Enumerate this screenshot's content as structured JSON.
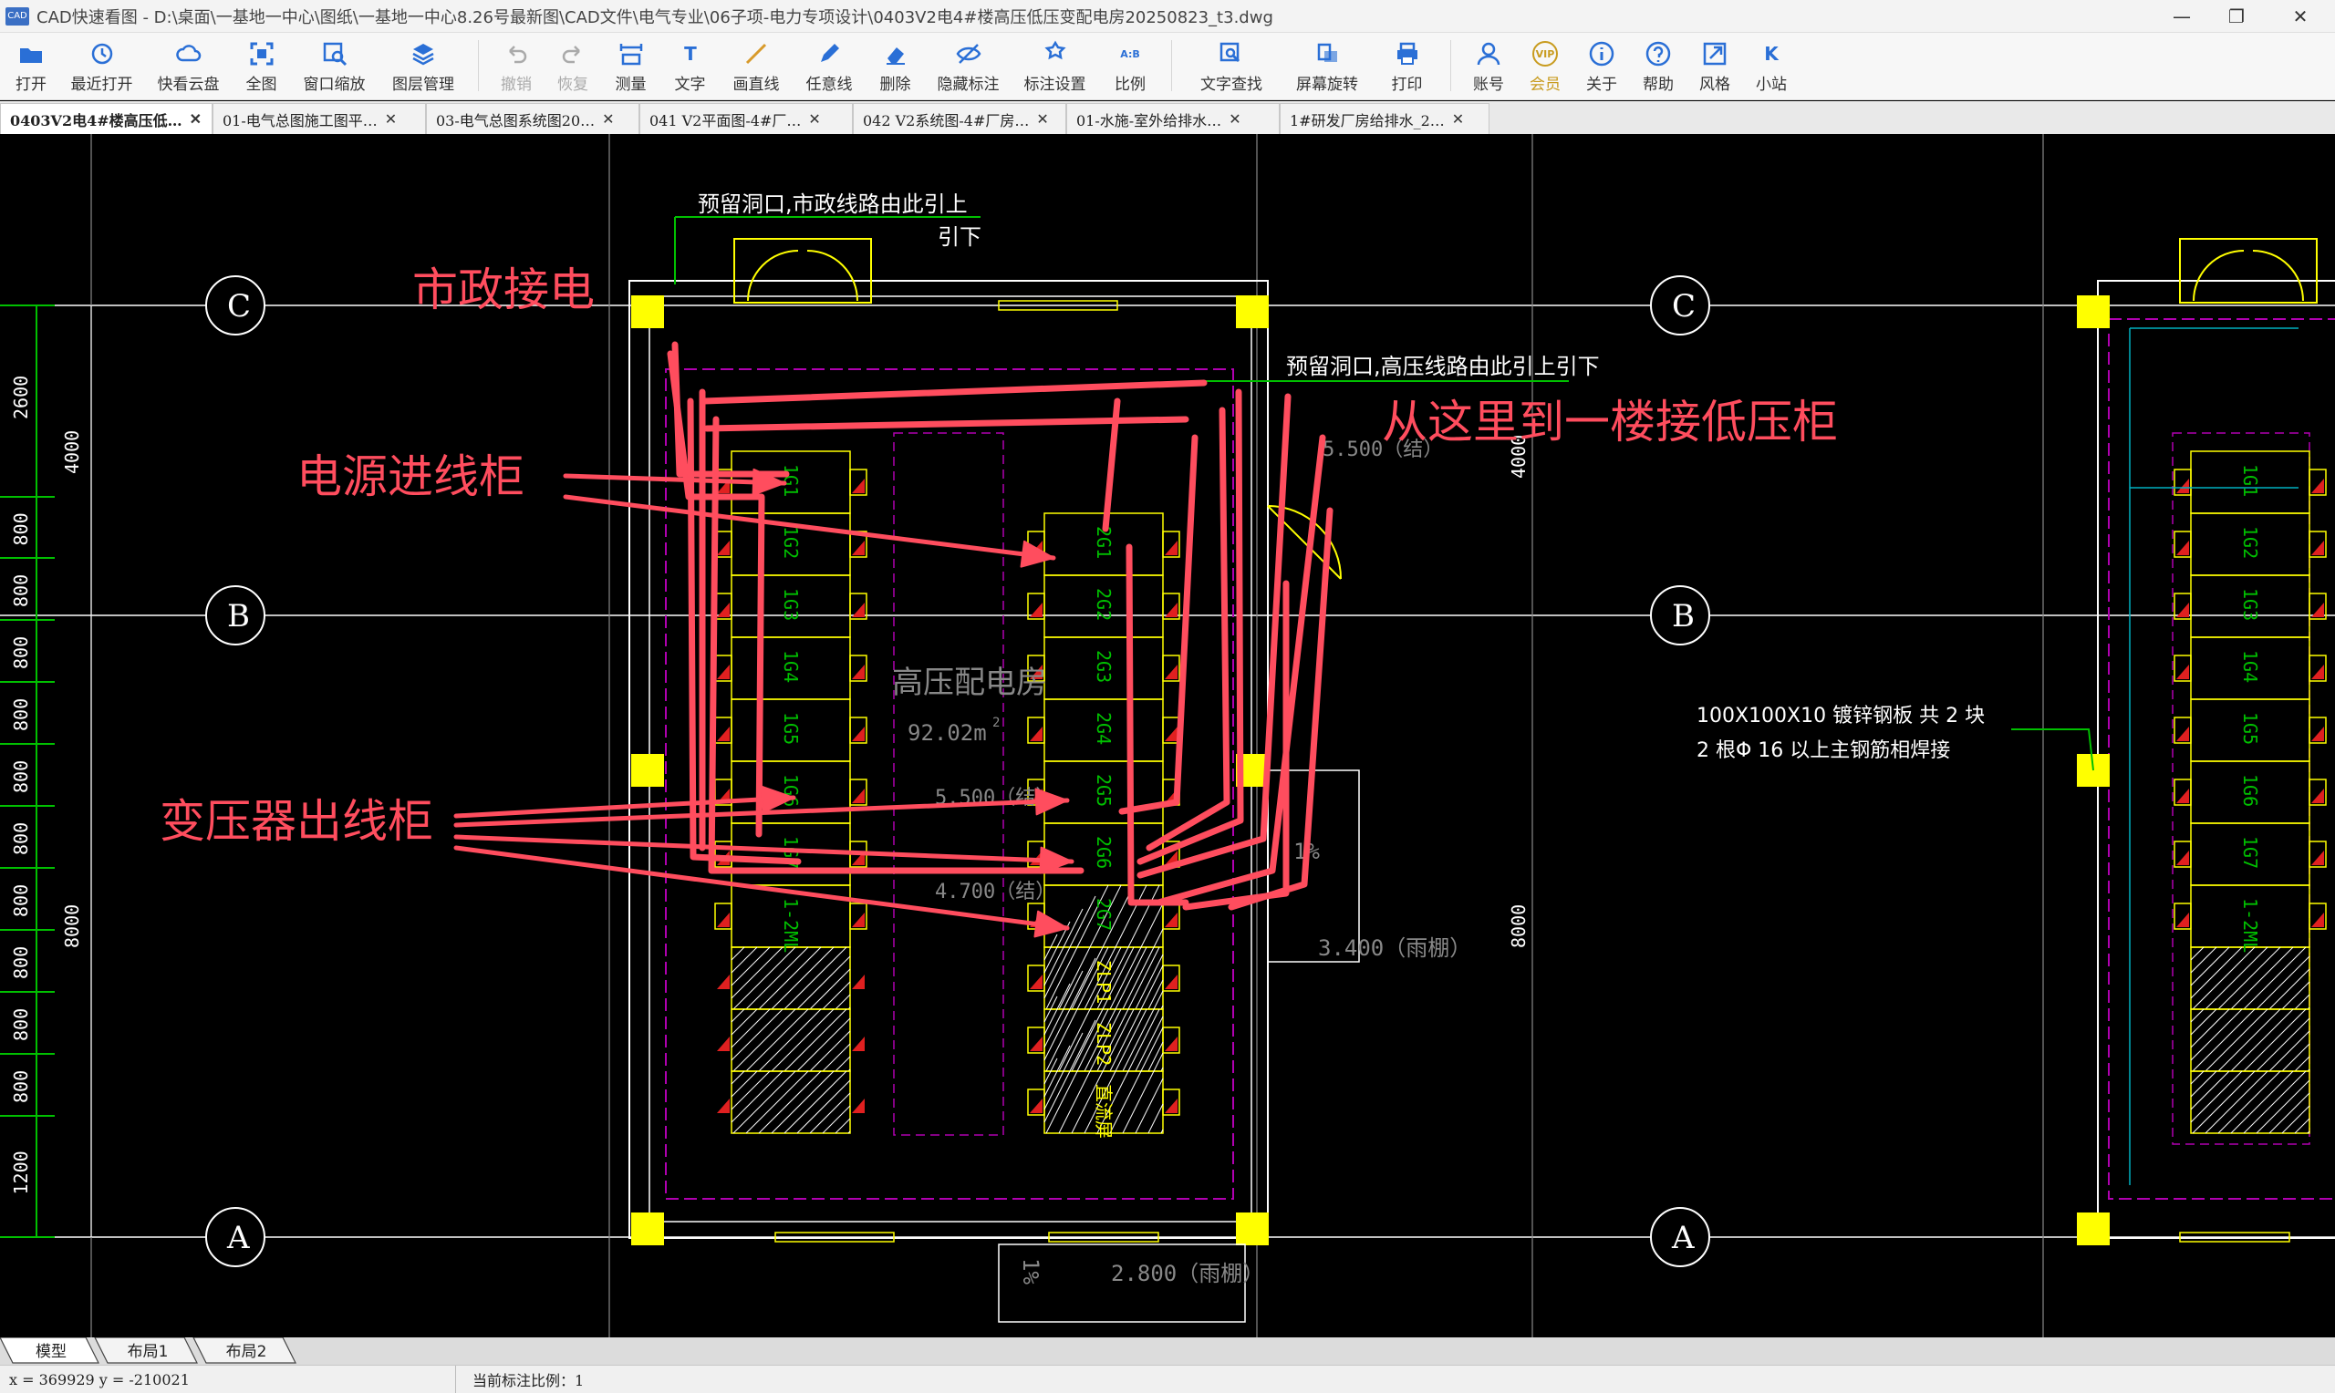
{
  "window": {
    "title": "CAD快速看图 - D:\\桌面\\一基地一中心\\图纸\\一基地一中心8.26号最新图\\CAD文件\\电气专业\\06子项-电力专项设计\\0403V2电4#楼高压低压变配电房20250823_t3.dwg",
    "logo": "CAD",
    "minimize": "—",
    "maximize": "❐",
    "close": "✕"
  },
  "toolbar": [
    {
      "label": "打开",
      "icon": "folder-icon",
      "state": "normal"
    },
    {
      "label": "最近打开",
      "icon": "clock-icon",
      "state": "normal"
    },
    {
      "label": "快看云盘",
      "icon": "cloud-icon",
      "state": "normal"
    },
    {
      "label": "全图",
      "icon": "fit-icon",
      "state": "normal"
    },
    {
      "label": "窗口缩放",
      "icon": "window-zoom-icon",
      "state": "normal"
    },
    {
      "label": "图层管理",
      "icon": "layers-icon",
      "state": "normal"
    },
    {
      "label": "撤销",
      "icon": "undo-icon",
      "state": "disabled"
    },
    {
      "label": "恢复",
      "icon": "redo-icon",
      "state": "disabled"
    },
    {
      "label": "测量",
      "icon": "measure-icon",
      "state": "normal"
    },
    {
      "label": "文字",
      "icon": "text-icon",
      "state": "normal"
    },
    {
      "label": "画直线",
      "icon": "line-icon",
      "state": "normal"
    },
    {
      "label": "任意线",
      "icon": "pen-icon",
      "state": "normal"
    },
    {
      "label": "删除",
      "icon": "eraser-icon",
      "state": "normal"
    },
    {
      "label": "隐藏标注",
      "icon": "eye-off-icon",
      "state": "normal"
    },
    {
      "label": "标注设置",
      "icon": "annotation-settings-icon",
      "state": "normal"
    },
    {
      "label": "比例",
      "icon": "scale-icon",
      "state": "normal"
    },
    {
      "label": "文字查找",
      "icon": "text-search-icon",
      "state": "normal"
    },
    {
      "label": "屏幕旋转",
      "icon": "rotate-icon",
      "state": "normal"
    },
    {
      "label": "打印",
      "icon": "printer-icon",
      "state": "normal"
    },
    {
      "label": "账号",
      "icon": "user-icon",
      "state": "normal"
    },
    {
      "label": "会员",
      "icon": "vip-icon",
      "state": "gold"
    },
    {
      "label": "关于",
      "icon": "info-icon",
      "state": "normal"
    },
    {
      "label": "帮助",
      "icon": "help-icon",
      "state": "normal"
    },
    {
      "label": "风格",
      "icon": "style-icon",
      "state": "normal"
    },
    {
      "label": "小站",
      "icon": "k-site-icon",
      "state": "normal"
    }
  ],
  "icon_glyphs": {
    "scale-icon": "A:B",
    "vip-icon": "VIP",
    "k-site-icon": "K",
    "text-icon": "T"
  },
  "tabs": [
    {
      "label": "0403V2电4#楼高压低…",
      "active": true
    },
    {
      "label": "01-电气总图施工图平…",
      "active": false
    },
    {
      "label": "03-电气总图系统图20…",
      "active": false
    },
    {
      "label": "041 V2平面图-4#厂…",
      "active": false
    },
    {
      "label": "042 V2系统图-4#厂房…",
      "active": false
    },
    {
      "label": "01-水施-室外给排水…",
      "active": false
    },
    {
      "label": "1#研发厂房给排水_2…",
      "active": false
    }
  ],
  "tab_close": "✕",
  "drawing": {
    "axis_labels": {
      "C": "C",
      "B": "B",
      "A": "A"
    },
    "left_dims": [
      "2600",
      "800",
      "800",
      "800",
      "800",
      "800",
      "800",
      "800",
      "800",
      "800",
      "800",
      "1200"
    ],
    "left_dims2": [
      "4000",
      "8000"
    ],
    "right_dims": [
      "4000",
      "8000"
    ],
    "note_top1": "预留洞口,市政线路由此引上",
    "note_top1b": "引下",
    "note_top2": "预留洞口,高压线路由此引上引下",
    "room_name": "高压配电房",
    "room_area": "92.02m",
    "room_area_sup": "2",
    "elev_5500_top": "5.500（结）",
    "elev_5500_mid": "5.500（结）",
    "elev_4700": "4.700（结）",
    "elev_3400": "3.400（雨棚）",
    "elev_2800": "2.800（雨棚）",
    "slope1": "1%",
    "slope2": "1%",
    "steel_note1": "100X100X10        镀锌钢板 共    2 块",
    "steel_note2": "2 根Φ 16   以上主钢筋相焊接",
    "left_cabinets": [
      "1G1",
      "1G2",
      "1G3",
      "1G4",
      "1G5",
      "1G6",
      "1G7",
      "1-2ML"
    ],
    "right_cabinets": [
      "2G1",
      "2G2",
      "2G3",
      "2G4",
      "2G5",
      "2G6",
      "2G7",
      "ZLP1",
      "ZLP2",
      "直流屏"
    ],
    "far_right_cabinets": [
      "1G1",
      "1G2",
      "1G3",
      "1G4",
      "1G5",
      "1G6",
      "1G7",
      "1-2ML"
    ]
  },
  "annotations": {
    "municipal": "市政接电",
    "incoming": "电源进线柜",
    "to_low_voltage": "从这里到一楼接低压柜",
    "transformer_out": "变压器出线柜"
  },
  "colors": {
    "annotation_red": "#ff4d5e",
    "cad_white": "#ffffff",
    "cad_yellow": "#ffff00",
    "cad_magenta": "#b000b0",
    "cad_green": "#00c000",
    "cad_cyan": "#00b0c0"
  },
  "layout_tabs": [
    "模型",
    "布局1",
    "布局2"
  ],
  "status": {
    "coords": "x = 369929  y = -210021",
    "scale": "当前标注比例：1"
  }
}
